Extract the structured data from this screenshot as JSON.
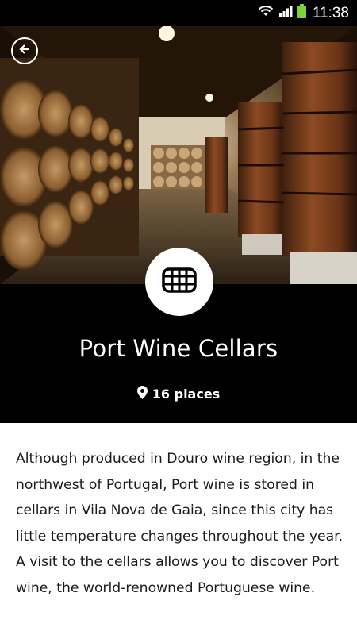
{
  "status_bar": {
    "time": "11:38",
    "icons": [
      "wifi-icon",
      "signal-icon",
      "battery-icon"
    ]
  },
  "header": {
    "back_icon": "arrow-left-circle-icon",
    "category_icon": "barrel-icon",
    "title": "Port Wine Cellars",
    "places_icon": "map-pin-icon",
    "places_label": "16 places"
  },
  "content": {
    "description": "Although produced in Douro wine region, in the northwest of Portugal, Port wine is stored in cellars in Vila Nova de Gaia, since this city has little temperature changes throughout the year. A visit to the cellars allows you to discover Port wine, the world-renowned Portuguese wine."
  },
  "colors": {
    "header_bg": "#000000",
    "text": "#1a1a1a",
    "background": "#ffffff"
  }
}
